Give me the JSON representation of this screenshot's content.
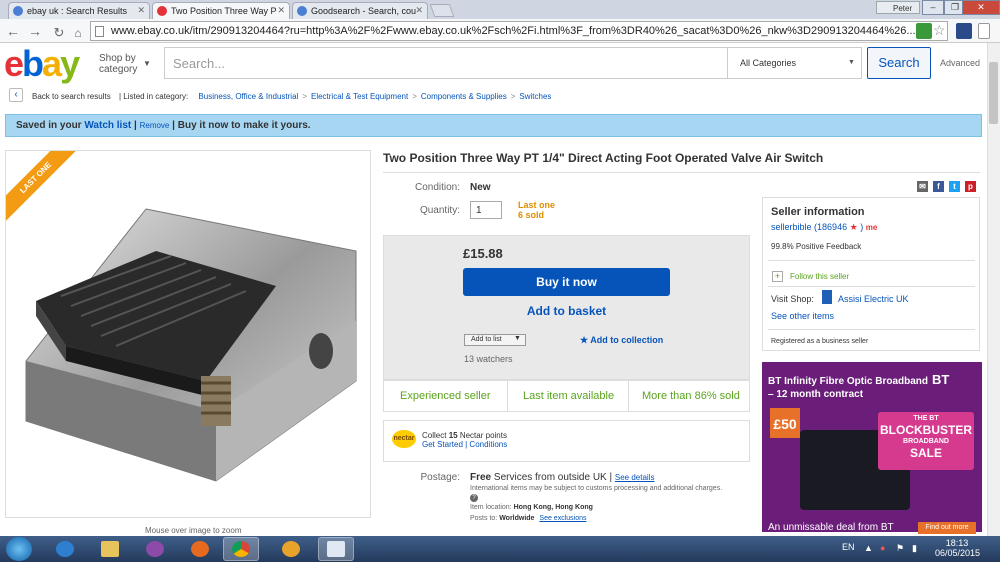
{
  "browser": {
    "tabs": [
      {
        "label": "ebay uk : Search Results"
      },
      {
        "label": "Two Position Three Way P"
      },
      {
        "label": "Goodsearch - Search, cou"
      }
    ],
    "user": "Peter",
    "url": "www.ebay.co.uk/itm/290913204464?ru=http%3A%2F%2Fwww.ebay.co.uk%2Fsch%2Fi.html%3F_from%3DR40%26_sacat%3D0%26_nkw%3D290913204464%26..."
  },
  "header": {
    "logo_e": "e",
    "logo_b": "b",
    "logo_a": "a",
    "logo_y": "y",
    "shop_by_line1": "Shop by",
    "shop_by_line2": "category",
    "search_placeholder": "Search...",
    "category_select": "All Categories",
    "search_button": "Search",
    "advanced": "Advanced"
  },
  "breadcrumb": {
    "back": "Back to search results",
    "listed": "| Listed in category:",
    "items": [
      "Business, Office & Industrial",
      "Electrical & Test Equipment",
      "Components & Supplies",
      "Switches"
    ]
  },
  "saved_bar": {
    "saved": "Saved in your",
    "watch_list": "Watch list",
    "pipe1": "|",
    "remove": "Remove",
    "rest": "| Buy it now to make it yours."
  },
  "image": {
    "ribbon": "LAST ONE",
    "hover_hint": "Mouse over image to zoom"
  },
  "item": {
    "title": "Two Position Three Way PT 1/4\" Direct Acting Foot Operated Valve Air Switch",
    "condition_label": "Condition:",
    "condition_value": "New",
    "quantity_label": "Quantity:",
    "quantity_value": "1",
    "last_one": "Last one",
    "sold": "6 sold",
    "price": "£15.88",
    "buy_now": "Buy it now",
    "add_to_basket": "Add to basket",
    "add_to_list": "Add to list",
    "add_to_collection": "Add to collection",
    "watchers": "13 watchers",
    "trust": [
      "Experienced seller",
      "Last item available",
      "More than 86% sold"
    ],
    "nectar_collect": "Collect",
    "nectar_points": "15",
    "nectar_rest": "Nectar points",
    "nectar_links": "Get Started | Conditions",
    "nectar_logo": "nectar",
    "postage_label": "Postage:",
    "postage_free": "Free",
    "postage_services": "Services from outside UK |",
    "postage_see": "See details",
    "intl_note": "International items may be subject to customs processing and additional charges.",
    "location_label": "Item location:",
    "location_value": "Hong Kong, Hong Kong",
    "posts_label": "Posts to:",
    "posts_value": "Worldwide",
    "see_exclusions": "See exclusions"
  },
  "seller": {
    "title": "Seller information",
    "name": "sellerbible",
    "score": "(186946",
    "close": ")",
    "me": "me",
    "feedback": "99.8% Positive Feedback",
    "follow": "Follow this seller",
    "visit_shop": "Visit Shop:",
    "shop_name": "Assisi Electric UK",
    "other_items": "See other items",
    "registered": "Registered as a business seller"
  },
  "ad": {
    "line1": "BT Infinity Fibre Optic Broadband",
    "line2": "– 12 month contract",
    "bt": "BT",
    "gift": "£50",
    "bb_top": "THE BT",
    "bb_big": "BLOCKBUSTER",
    "bb_mid": "BROADBAND",
    "bb_sale": "SALE",
    "line3": "An unmissable deal from BT",
    "find_out": "Find out more"
  },
  "taskbar": {
    "lang": "EN",
    "time": "18:13",
    "date": "06/05/2015"
  },
  "colors": {
    "ebay_blue": "#0654ba",
    "ebay_red": "#e53238",
    "ebay_yellow": "#f5af02",
    "ebay_green": "#86b817",
    "trust_green": "#5ba41d",
    "saved_bar": "#a6d6f2",
    "last_one_orange": "#dd8f00"
  }
}
